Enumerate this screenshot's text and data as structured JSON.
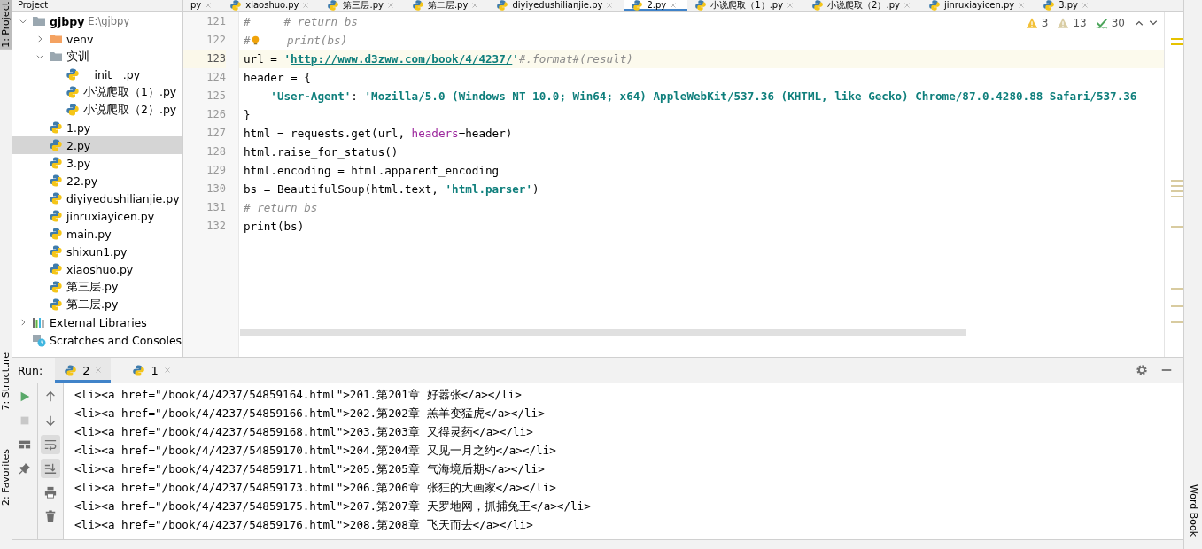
{
  "left_strip": [
    {
      "label": "1: Project",
      "selected": true
    },
    {
      "label": "7: Structure",
      "selected": false
    },
    {
      "label": "2: Favorites",
      "selected": false
    }
  ],
  "right_strip": [
    {
      "label": "Word Book",
      "selected": false
    }
  ],
  "project": {
    "title": "Project",
    "tree": [
      {
        "label": "gjbpy",
        "path": "E:\\gjbpy",
        "kind": "folder",
        "expanded": true,
        "selected": false,
        "children": [
          {
            "label": "venv",
            "kind": "venv",
            "expanded": false,
            "selected": false
          },
          {
            "label": "实训",
            "kind": "folder",
            "expanded": true,
            "selected": false,
            "children": [
              {
                "label": "__init__.py",
                "kind": "python",
                "selected": false
              },
              {
                "label": "小说爬取（1）.py",
                "kind": "python",
                "selected": false
              },
              {
                "label": "小说爬取（2）.py",
                "kind": "python",
                "selected": false
              }
            ]
          },
          {
            "label": "1.py",
            "kind": "python",
            "selected": false
          },
          {
            "label": "2.py",
            "kind": "python",
            "selected": true
          },
          {
            "label": "3.py",
            "kind": "python",
            "selected": false
          },
          {
            "label": "22.py",
            "kind": "python",
            "selected": false
          },
          {
            "label": "diyiyedushilianjie.py",
            "kind": "python",
            "selected": false
          },
          {
            "label": "jinruxiayicen.py",
            "kind": "python",
            "selected": false
          },
          {
            "label": "main.py",
            "kind": "python",
            "selected": false
          },
          {
            "label": "shixun1.py",
            "kind": "python",
            "selected": false
          },
          {
            "label": "xiaoshuo.py",
            "kind": "python",
            "selected": false
          },
          {
            "label": "第三层.py",
            "kind": "python",
            "selected": false
          },
          {
            "label": "第二层.py",
            "kind": "python",
            "selected": false
          }
        ]
      },
      {
        "label": "External Libraries",
        "kind": "libraries",
        "expanded": false,
        "selected": false
      },
      {
        "label": "Scratches and Consoles",
        "kind": "scratches",
        "selected": false
      }
    ]
  },
  "editor_tabs": [
    {
      "label": "py",
      "selected": false
    },
    {
      "label": "xiaoshuo.py",
      "selected": false
    },
    {
      "label": "第三层.py",
      "selected": false
    },
    {
      "label": "第二层.py",
      "selected": false
    },
    {
      "label": "diyiyedushilianjie.py",
      "selected": false
    },
    {
      "label": "2.py",
      "selected": true
    },
    {
      "label": "小说爬取（1）.py",
      "selected": false
    },
    {
      "label": "小说爬取（2）.py",
      "selected": false
    },
    {
      "label": "jinruxiayicen.py",
      "selected": false
    },
    {
      "label": "3.py",
      "selected": false
    }
  ],
  "inspections": [
    {
      "kind": "warning",
      "count": "3"
    },
    {
      "kind": "weak",
      "count": "13"
    },
    {
      "kind": "typo",
      "count": "30"
    }
  ],
  "code": [
    {
      "number": "121",
      "current": false,
      "tokens": [
        {
          "kind": "comment",
          "text": "#     # return bs"
        }
      ]
    },
    {
      "number": "122",
      "current": false,
      "bulb": true,
      "tokens": [
        {
          "kind": "comment",
          "text": "#"
        },
        {
          "kind": "comment",
          "text": "    print(bs)"
        }
      ]
    },
    {
      "number": "123",
      "current": true,
      "tokens": [
        {
          "kind": "plain",
          "text": "url = "
        },
        {
          "kind": "string",
          "text": "'"
        },
        {
          "kind": "url",
          "text": "http://www.d3zww.com/book/4/4237/"
        },
        {
          "kind": "string",
          "text": "'"
        },
        {
          "kind": "comment",
          "text": "#.format#(result)"
        }
      ]
    },
    {
      "number": "124",
      "current": false,
      "tokens": [
        {
          "kind": "plain",
          "text": "header = {"
        }
      ]
    },
    {
      "number": "125",
      "current": false,
      "indented": true,
      "tokens": [
        {
          "kind": "string",
          "text": "'User-Agent'"
        },
        {
          "kind": "plain",
          "text": ": "
        },
        {
          "kind": "string",
          "text": "'Mozilla/5.0 (Windows NT 10.0; Win64; x64) AppleWebKit/537.36 (KHTML, like Gecko) Chrome/87.0.4280.88 Safari/537.36"
        }
      ]
    },
    {
      "number": "126",
      "current": false,
      "tokens": [
        {
          "kind": "plain",
          "text": "}"
        }
      ]
    },
    {
      "number": "127",
      "current": false,
      "tokens": [
        {
          "kind": "plain",
          "text": "html = requests.get(url, "
        },
        {
          "kind": "param",
          "text": "headers"
        },
        {
          "kind": "plain",
          "text": "=header)"
        }
      ]
    },
    {
      "number": "128",
      "current": false,
      "tokens": [
        {
          "kind": "plain",
          "text": "html.raise_for_status()"
        }
      ]
    },
    {
      "number": "129",
      "current": false,
      "tokens": [
        {
          "kind": "plain",
          "text": "html.encoding = html.apparent_encoding"
        }
      ]
    },
    {
      "number": "130",
      "current": false,
      "tokens": [
        {
          "kind": "plain",
          "text": "bs = BeautifulSoup(html.text, "
        },
        {
          "kind": "string",
          "text": "'html.parser'"
        },
        {
          "kind": "plain",
          "text": ")"
        }
      ]
    },
    {
      "number": "131",
      "current": false,
      "tokens": [
        {
          "kind": "comment",
          "text": "# return bs"
        }
      ]
    },
    {
      "number": "132",
      "current": false,
      "tokens": [
        {
          "kind": "plain",
          "text": "print(bs)"
        }
      ]
    }
  ],
  "run": {
    "label": "Run:",
    "tabs": [
      {
        "label": "2",
        "selected": true
      },
      {
        "label": "1",
        "selected": false
      }
    ],
    "tools_left": [
      {
        "kind": "run"
      },
      {
        "kind": "stop"
      },
      {
        "kind": "layout"
      },
      {
        "kind": "pin"
      }
    ],
    "tools_right": [
      {
        "kind": "up",
        "on": false
      },
      {
        "kind": "down",
        "on": false
      },
      {
        "kind": "wrap",
        "on": true
      },
      {
        "kind": "scroll-end",
        "on": true
      },
      {
        "kind": "print",
        "on": false
      },
      {
        "kind": "trash",
        "on": false
      }
    ],
    "output": [
      "<li><a href=\"/book/4/4237/54859164.html\">201.第201章 好嚣张</a></li>",
      "<li><a href=\"/book/4/4237/54859166.html\">202.第202章 羔羊变猛虎</a></li>",
      "<li><a href=\"/book/4/4237/54859168.html\">203.第203章 又得灵药</a></li>",
      "<li><a href=\"/book/4/4237/54859170.html\">204.第204章 又见一月之约</a></li>",
      "<li><a href=\"/book/4/4237/54859171.html\">205.第205章 气海境后期</a></li>",
      "<li><a href=\"/book/4/4237/54859173.html\">206.第206章 张狂的大画家</a></li>",
      "<li><a href=\"/book/4/4237/54859175.html\">207.第207章 天罗地网，抓捕兔王</a></li>",
      "<li><a href=\"/book/4/4237/54859176.html\">208.第208章 飞天而去</a></li>"
    ]
  }
}
